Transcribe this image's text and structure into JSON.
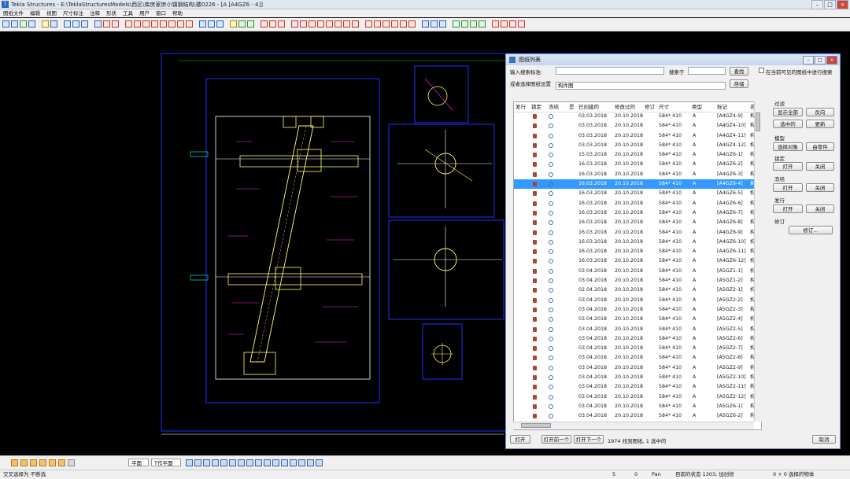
{
  "titlebar": {
    "title": "Tekla Structures - E:\\TeklaStructuresModels\\西区\\库房家房小镇钢结构\\楼0226 - [A   [A4GZ6 - 4]]",
    "min": "–",
    "max": "□",
    "close": "×"
  },
  "menubar": [
    "图纸文件",
    "编辑",
    "视图",
    "尺寸标注",
    "注释",
    "形状",
    "工具",
    "用户",
    "窗口",
    "帮助"
  ],
  "bottombar": {
    "plane_select": "平面",
    "workplane_select": "T作平面"
  },
  "statusbar": {
    "left_text": "交叉选择为 不断选",
    "field1": "5",
    "field2": "0",
    "mode": "Pan",
    "status": "目前的状态 1303, 加创修",
    "selection": "0 + 0 选择的物体"
  },
  "dialog": {
    "title": "图纸列表",
    "search_label": "输入搜索标准:",
    "search_value": "",
    "search_in_label": "搜索于",
    "search_in_value": "",
    "search_button": "查找",
    "visible_only_label": "在当前可见的图纸中进行搜索",
    "settings_label": "或者选择图纸设置",
    "settings_value": "构件图",
    "save_button": "存储",
    "columns": [
      "发行",
      "锁定",
      "冻结",
      "昰",
      "已创建的",
      "修改过的",
      "修订",
      "尺寸",
      "",
      "类型",
      "标记",
      "名称"
    ],
    "rows": [
      {
        "created": "03.03.2018",
        "modified": "20.10.2018",
        "size": "584* 410",
        "type": "A",
        "mark": "[A4GZ4-9]",
        "name": "构件"
      },
      {
        "created": "03.03.2018",
        "modified": "20.10.2018",
        "size": "584* 410",
        "type": "A",
        "mark": "[A4GZ4-10]",
        "name": "构件"
      },
      {
        "created": "03.03.2018",
        "modified": "20.10.2018",
        "size": "584* 410",
        "type": "A",
        "mark": "[A4GZ4-11]",
        "name": "构件"
      },
      {
        "created": "03.03.2018",
        "modified": "20.10.2018",
        "size": "584* 410",
        "type": "A",
        "mark": "[A4GZ4-12]",
        "name": "构件"
      },
      {
        "created": "15.03.2018",
        "modified": "20.10.2018",
        "size": "584* 410",
        "type": "A",
        "mark": "[A4GZ6-1]",
        "name": "构件"
      },
      {
        "created": "16.03.2018",
        "modified": "20.10.2018",
        "size": "584* 410",
        "type": "A",
        "mark": "[A4GZ6-2]",
        "name": "构件"
      },
      {
        "created": "16.03.2018",
        "modified": "20.10.2018",
        "size": "584* 410",
        "type": "A",
        "mark": "[A4GZ6-3]",
        "name": "构件"
      },
      {
        "created": "16.03.2018",
        "modified": "20.10.2018",
        "size": "584* 410",
        "type": "A",
        "mark": "[A4GZ6-4]",
        "name": "构件",
        "selected": true
      },
      {
        "created": "16.03.2018",
        "modified": "20.10.2018",
        "size": "584* 410",
        "type": "A",
        "mark": "[A4GZ6-5]",
        "name": "构件"
      },
      {
        "created": "16.03.2018",
        "modified": "20.10.2018",
        "size": "584* 410",
        "type": "A",
        "mark": "[A4GZ6-6]",
        "name": "构件"
      },
      {
        "created": "16.03.2018",
        "modified": "20.10.2018",
        "size": "584* 410",
        "type": "A",
        "mark": "[A4GZ6-7]",
        "name": "构件"
      },
      {
        "created": "16.03.2018",
        "modified": "20.10.2018",
        "size": "584* 410",
        "type": "A",
        "mark": "[A4GZ6-8]",
        "name": "构件"
      },
      {
        "created": "16.03.2018",
        "modified": "20.10.2018",
        "size": "584* 410",
        "type": "A",
        "mark": "[A4GZ6-9]",
        "name": "构件"
      },
      {
        "created": "16.03.2018",
        "modified": "20.10.2018",
        "size": "584* 410",
        "type": "A",
        "mark": "[A4GZ6-10]",
        "name": "构件"
      },
      {
        "created": "16.03.2018",
        "modified": "20.10.2018",
        "size": "584* 410",
        "type": "A",
        "mark": "[A4GZ6-11]",
        "name": "构件"
      },
      {
        "created": "16.03.2018",
        "modified": "20.10.2018",
        "size": "584* 410",
        "type": "A",
        "mark": "[A4GZ6-12]",
        "name": "构件"
      },
      {
        "created": "03.04.2018",
        "modified": "20.10.2018",
        "size": "584* 410",
        "type": "A",
        "mark": "[A5GZ1-1]",
        "name": "构件"
      },
      {
        "created": "03.04.2018",
        "modified": "20.10.2018",
        "size": "584* 410",
        "type": "A",
        "mark": "[A5GZ1-2]",
        "name": "构件"
      },
      {
        "created": "02.04.2018",
        "modified": "20.10.2018",
        "size": "584* 410",
        "type": "A",
        "mark": "[A5GZ2-1]",
        "name": "构件"
      },
      {
        "created": "03.04.2018",
        "modified": "20.10.2018",
        "size": "584* 410",
        "type": "A",
        "mark": "[A5GZ2-2]",
        "name": "构件"
      },
      {
        "created": "03.04.2018",
        "modified": "20.10.2018",
        "size": "584* 410",
        "type": "A",
        "mark": "[A5GZ2-3]",
        "name": "构件"
      },
      {
        "created": "03.04.2018",
        "modified": "20.10.2018",
        "size": "584* 410",
        "type": "A",
        "mark": "[A5GZ2-4]",
        "name": "构件"
      },
      {
        "created": "03.04.2018",
        "modified": "20.10.2018",
        "size": "584* 410",
        "type": "A",
        "mark": "[A5GZ2-5]",
        "name": "构件"
      },
      {
        "created": "03.04.2018",
        "modified": "20.10.2018",
        "size": "584* 410",
        "type": "A",
        "mark": "[A5GZ2-6]",
        "name": "构件"
      },
      {
        "created": "03.04.2018",
        "modified": "20.10.2018",
        "size": "584* 410",
        "type": "A",
        "mark": "[A5GZ2-7]",
        "name": "构件"
      },
      {
        "created": "03.04.2018",
        "modified": "20.10.2018",
        "size": "584* 410",
        "type": "A",
        "mark": "[A5GZ2-8]",
        "name": "构件"
      },
      {
        "created": "03.04.2018",
        "modified": "20.10.2018",
        "size": "584* 410",
        "type": "A",
        "mark": "[A5GZ2-9]",
        "name": "构件"
      },
      {
        "created": "03.04.2018",
        "modified": "20.10.2018",
        "size": "584* 410",
        "type": "A",
        "mark": "[A5GZ2-10]",
        "name": "构件"
      },
      {
        "created": "03.04.2018",
        "modified": "20.10.2018",
        "size": "584* 410",
        "type": "A",
        "mark": "[A5GZ2-11]",
        "name": "构件"
      },
      {
        "created": "03.04.2018",
        "modified": "20.10.2018",
        "size": "584* 410",
        "type": "A",
        "mark": "[A5GZ2-12]",
        "name": "构件"
      },
      {
        "created": "03.04.2018",
        "modified": "20.10.2018",
        "size": "584* 410",
        "type": "A",
        "mark": "[A5GZ6-1]",
        "name": "构件"
      },
      {
        "created": "03.04.2018",
        "modified": "20.10.2018",
        "size": "584* 410",
        "type": "A",
        "mark": "[A5GZ6-2]",
        "name": "构件"
      }
    ],
    "side": {
      "filter_label": "过滤",
      "show_all": "显示全部",
      "reverse": "反向",
      "selected": "选中的",
      "refresh": "更新",
      "model_label": "模型",
      "select_objects": "选择对象",
      "by_part": "由零件",
      "lock_label": "锁定",
      "lock_on": "打开",
      "lock_off": "关闭",
      "freeze_label": "冻结",
      "freeze_on": "打开",
      "freeze_off": "关闭",
      "issue_label": "发行",
      "issue_on": "打开",
      "issue_off": "关闭",
      "revision_label": "修订",
      "revise": "修订..."
    },
    "footer": {
      "open": "打开",
      "open_prev": "打开前一个",
      "open_next": "打开下一个",
      "summary": "1974 找到图纸, 1 选中的",
      "cancel": "取消"
    }
  },
  "colors": {
    "drawing_frame": "#1f2fff",
    "drawing_lines": "#ffffff",
    "dimensions": "#ff2bff",
    "members": "#ffff66",
    "annotations": "#00ffff",
    "selection": "#3399ff"
  }
}
